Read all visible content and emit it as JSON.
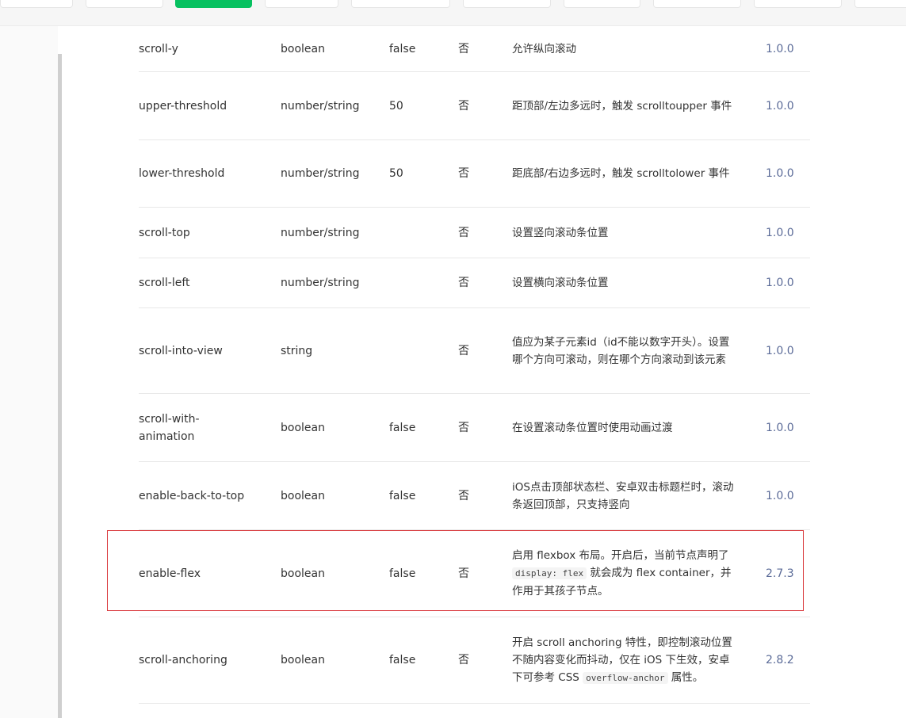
{
  "colors": {
    "accent_tab": "#07c160",
    "highlight_border": "#d9383c",
    "version_text": "#5b6b98"
  },
  "rows": [
    {
      "name": "scroll-y",
      "type": "boolean",
      "default": "false",
      "required": "否",
      "desc": "允许纵向滚动",
      "version": "1.0.0"
    },
    {
      "name": "upper-threshold",
      "type": "number/string",
      "default": "50",
      "required": "否",
      "desc": "距顶部/左边多远时，触发 scrolltoupper 事件",
      "version": "1.0.0"
    },
    {
      "name": "lower-threshold",
      "type": "number/string",
      "default": "50",
      "required": "否",
      "desc": "距底部/右边多远时，触发 scrolltolower 事件",
      "version": "1.0.0"
    },
    {
      "name": "scroll-top",
      "type": "number/string",
      "default": "",
      "required": "否",
      "desc": "设置竖向滚动条位置",
      "version": "1.0.0"
    },
    {
      "name": "scroll-left",
      "type": "number/string",
      "default": "",
      "required": "否",
      "desc": "设置横向滚动条位置",
      "version": "1.0.0"
    },
    {
      "name": "scroll-into-view",
      "type": "string",
      "default": "",
      "required": "否",
      "desc": "值应为某子元素id（id不能以数字开头）。设置哪个方向可滚动，则在哪个方向滚动到该元素",
      "version": "1.0.0"
    },
    {
      "name": "scroll-with-animation",
      "type": "boolean",
      "default": "false",
      "required": "否",
      "desc": "在设置滚动条位置时使用动画过渡",
      "version": "1.0.0"
    },
    {
      "name": "enable-back-to-top",
      "type": "boolean",
      "default": "false",
      "required": "否",
      "desc": "iOS点击顶部状态栏、安卓双击标题栏时，滚动条返回顶部，只支持竖向",
      "version": "1.0.0"
    },
    {
      "name": "enable-flex",
      "type": "boolean",
      "default": "false",
      "required": "否",
      "desc_before": "启用 flexbox 布局。开启后，当前节点声明了 ",
      "desc_code": "display: flex",
      "desc_after": " 就会成为 flex container，并作用于其孩子节点。",
      "version": "2.7.3"
    },
    {
      "name": "scroll-anchoring",
      "type": "boolean",
      "default": "false",
      "required": "否",
      "desc_before": "开启 scroll anchoring 特性，即控制滚动位置不随内容变化而抖动，仅在 iOS 下生效，安卓下可参考 CSS ",
      "desc_code": "overflow-anchor",
      "desc_after": " 属性。",
      "version": "2.8.2"
    }
  ]
}
